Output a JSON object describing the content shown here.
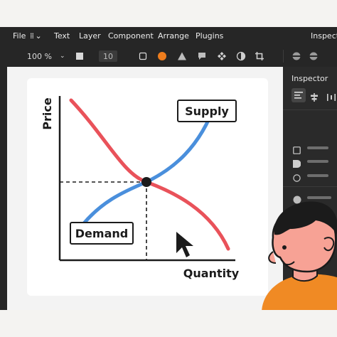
{
  "menubar": {
    "items": [
      "File",
      "Text",
      "Layer",
      "Component",
      "Arrange",
      "Plugins",
      "Inspect"
    ]
  },
  "toolbar": {
    "zoom": "100 %",
    "stroke_width": "10",
    "accent_color": "#ee7d1d"
  },
  "inspector": {
    "title": "Inspector"
  },
  "chart": {
    "ylabel": "Price",
    "xlabel": "Quantity",
    "supply_label": "Supply",
    "demand_label": "Demand",
    "supply_color": "#4a8fdc",
    "demand_color": "#e9525a"
  }
}
